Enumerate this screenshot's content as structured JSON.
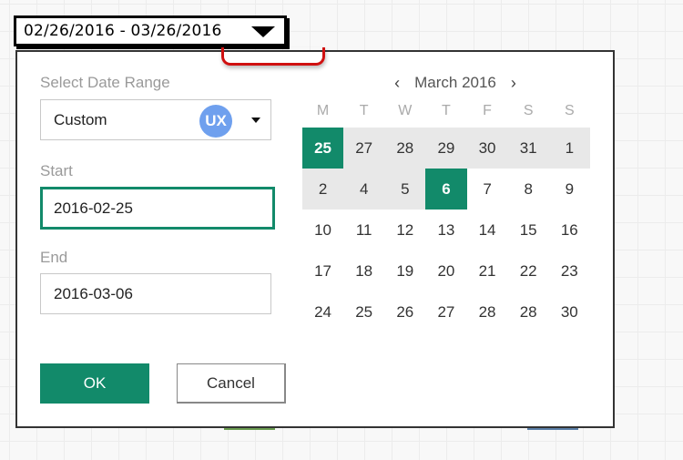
{
  "trigger": {
    "range_text": "02/26/2016 - 03/26/2016",
    "icon": "caret-down-icon"
  },
  "panel": {
    "select_label": "Select Date Range",
    "select_value": "Custom",
    "badge": "UX",
    "start_label": "Start",
    "start_value": "2016-02-25",
    "end_label": "End",
    "end_value": "2016-03-06",
    "ok_label": "OK",
    "cancel_label": "Cancel"
  },
  "calendar": {
    "month_title": "March 2016",
    "prev_icon": "‹",
    "next_icon": "›",
    "weekdays": [
      "M",
      "T",
      "W",
      "T",
      "F",
      "S",
      "S"
    ],
    "weeks": [
      [
        {
          "d": "25",
          "s": "selected"
        },
        {
          "d": "27",
          "s": "inrange"
        },
        {
          "d": "28",
          "s": "inrange"
        },
        {
          "d": "29",
          "s": "inrange"
        },
        {
          "d": "30",
          "s": "inrange"
        },
        {
          "d": "31",
          "s": "inrange"
        },
        {
          "d": "1",
          "s": "inrange"
        }
      ],
      [
        {
          "d": "2",
          "s": "inrange"
        },
        {
          "d": "4",
          "s": "inrange"
        },
        {
          "d": "5",
          "s": "inrange"
        },
        {
          "d": "6",
          "s": "selected"
        },
        {
          "d": "7",
          "s": ""
        },
        {
          "d": "8",
          "s": ""
        },
        {
          "d": "9",
          "s": ""
        }
      ],
      [
        {
          "d": "10",
          "s": ""
        },
        {
          "d": "11",
          "s": ""
        },
        {
          "d": "12",
          "s": ""
        },
        {
          "d": "13",
          "s": ""
        },
        {
          "d": "14",
          "s": ""
        },
        {
          "d": "15",
          "s": ""
        },
        {
          "d": "16",
          "s": ""
        }
      ],
      [
        {
          "d": "17",
          "s": ""
        },
        {
          "d": "18",
          "s": ""
        },
        {
          "d": "19",
          "s": ""
        },
        {
          "d": "20",
          "s": ""
        },
        {
          "d": "21",
          "s": ""
        },
        {
          "d": "22",
          "s": ""
        },
        {
          "d": "23",
          "s": ""
        }
      ],
      [
        {
          "d": "24",
          "s": ""
        },
        {
          "d": "25",
          "s": ""
        },
        {
          "d": "26",
          "s": ""
        },
        {
          "d": "27",
          "s": ""
        },
        {
          "d": "28",
          "s": ""
        },
        {
          "d": "28",
          "s": ""
        },
        {
          "d": "30",
          "s": ""
        }
      ]
    ]
  },
  "colors": {
    "accent": "#128a6a",
    "range_bg": "#e8e8e8",
    "callout": "#d01010",
    "badge": "#6fa0ee"
  }
}
